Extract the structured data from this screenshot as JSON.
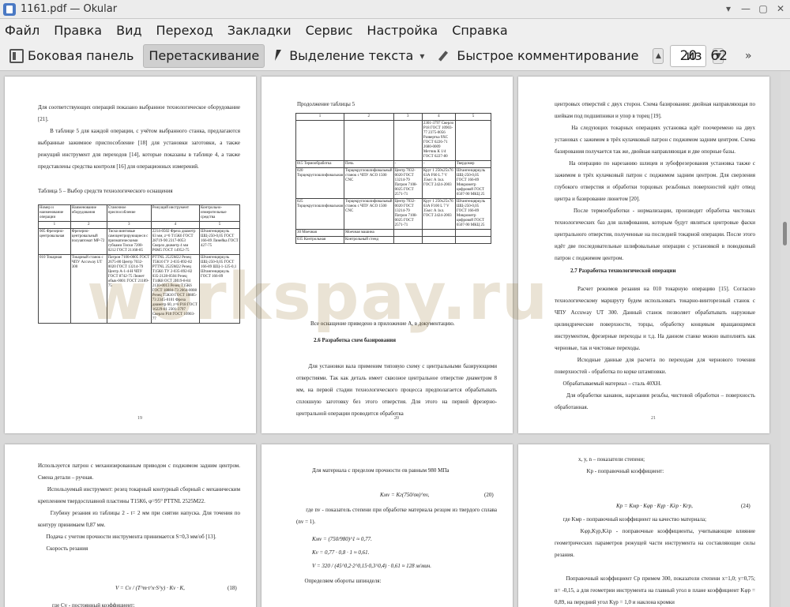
{
  "window": {
    "title": "1161.pdf — Okular",
    "controls": [
      "▾",
      "—",
      "▢",
      "✕"
    ]
  },
  "menu": [
    "Файл",
    "Правка",
    "Вид",
    "Переход",
    "Закладки",
    "Сервис",
    "Настройка",
    "Справка"
  ],
  "toolbar": {
    "sidebar": "Боковая панель",
    "drag": "Перетаскивание",
    "select_text": "Выделение текста",
    "quick_comment": "Быстрое комментирование",
    "current_page": "20",
    "of_label": "из",
    "total_pages": "62"
  },
  "watermark": "workspay.ru",
  "pages": {
    "p19": {
      "number": "19",
      "text": "Для соответствующих операций показано выбранное технологическое оборудование [21].\n      В таблице 5 для каждой операции, с учётом выбранного станка, предлагаются выбранные зажимное приспособление [18] для установки заготовки, а также режущий инструмент для переходов [14], которые показаны в таблице 4, а также представлены средства контроля [16] для операционных измерений.",
      "caption": "Таблица 5 – Выбор средств технологического оснащения",
      "table": [
        [
          "Номер и наименование операции",
          "Наименование оборудования",
          "Станочное приспособление",
          "Режущий инструмент",
          "Контрольно-измерительные средства"
        ],
        [
          "1",
          "2",
          "3",
          "4",
          "5"
        ],
        [
          "005 Фрезерно-центровальная",
          "Фрезерно-центровальный полуавтомат МР-72",
          "Тиски винтовые самоцентрирующиеся с призматическими губками Тиски 7200-0212 ГОСТ 21168-85",
          "2214-0502 Фреза диаметр 63 мм, z=6 Т15К6 ГОСТ 28719-90 2317-0053 Сверло диаметр 4 мм Р6М5 ГОСТ 14952-75",
          "Штангенциркуль ШЦ-250-0,05 ГОСТ 166-89 Линейка ГОСТ 427-75"
        ],
        [
          "010 Токарная",
          "Токарный станок с ЧПУ Accuway UT 300",
          "Патрон 7100-0005 ГОСТ 2675-80 Центр 7032-0020 ГОСТ 13214-79 Центр А-1-4-Н ЧПУ ГОСТ 8742-75 Люнет обык-0001 ГОСТ 21189-75",
          "PTTNL 2525M22 Резец T5К10 ГУ 2-035-892-82 PTTNL 2525M22 Резец T15К6 ТУ 2-035-892-82 035-2128-0504 Резец T14К8 ОСТ 2И19-8-84 2130-0013 Резец T15К6 ГОСТ 18884-73 2664-0008 Резец Т5К10 ГОСТ 18885-73 2345-0101 Фреза диаметр 60, z=8 Р18 ГОСТ 16229-81 2301-3797 Сверло Р18 ГОСТ 10903-77",
          "Штангенциркуль ШЦ-250-0,05 ГОСТ 166-89 ШЦ-1-125-0,1 Штангенциркуль ГОСТ 166-89"
        ]
      ]
    },
    "p20": {
      "number": "20",
      "title": "Продолжение таблицы 5",
      "table": [
        [
          "1",
          "2",
          "3",
          "4",
          "5"
        ],
        [
          "",
          "",
          "",
          "2301-3797 Сверло Р18 ГОСТ 10903-77 2375-0056 Развертка 9ХС ГОСТ 6226-71 2680-0009 Метчик К 1/4 ГОСТ 6227-80",
          ""
        ],
        [
          "015 Термообработка",
          "Печь",
          "-",
          "-",
          "Твердомер"
        ],
        [
          "020 Торцекруглошлифовальная",
          "Торцекруглошлифовальный станок с ЧПУ ACO 1500 CNC",
          "Центр 7032-0020 ГОСТ 13214-79 Патрон 7108-0025 ГОСТ 2571-71",
          "Круг 1 250х25х76 63А F60 L 7 V 35м/с А 1кл. ГОСТ 2424-2003",
          "Штангенциркуль ШЦ-250-0,05 ГОСТ 166-89 Микрометр цифровой ГОСТ 6507-90 МКЦ 25"
        ],
        [
          "025 Торцекруглошлифовальная",
          "Торцекруглошлифовальный станок с ЧПУ ACO 1500 CNC",
          "Центр 7032-0020 ГОСТ 13214-79 Патрон 7108-0025 ГОСТ 2571-71",
          "Круг 1 250х25х76 63А F100 L 7 V 35м/с А 1кл. ГОСТ 2424-2003",
          "Штангенциркуль ШЦ-250-0,05 ГОСТ 166-89 Микрометр цифровой ГОСТ 6507-90 МКЦ 25"
        ],
        [
          "30 Моечная",
          "Моечная машина",
          "",
          "",
          ""
        ],
        [
          "035 Контрольная",
          "Контрольный стенд",
          "",
          "",
          ""
        ]
      ],
      "note": "Все оснащение приведено в приложение А, в документацию.",
      "heading": "2.6 Разработка схем базирования",
      "text": "      Для установки вала применим типовую схему с центральными базирующими отверстиями. Так как деталь имеет сквозное центральное отверстие диаметром 8 мм, на первой стадии технологического процесса предполагается обрабатывать сплошную заготовку без этого отверстия. Для этого на первой фрезерно-центральной операции проводится обработка"
    },
    "p21": {
      "number": "21",
      "text1": "центровых отверстий с двух сторон. Схема базирования: двойная направляющая по шейкам под подшипники и упор в торец [19].\n      На следующих токарных операциях установка идёт поочеремено на двух установах с зажимом в трёх кулачковый патрон с поджимом задним центром. Схема базирования получается так же, двойная направляющая и две опорные базы.\n      На операцию по нарезанию шлицев и зубофрезерования установка также с зажимом в трёх кулачковый патрон с поджимом задним центром. Для сверления глубокого отверстия и обработки торцовых резьбовых поверхностей идёт отвод центра и базирование люнетом [20].\n      После термообработки - нормализации, производит обработка чистовых технологических баз для шлифования, которым будут являться центровые фаски центрального отверстия, полученные на последней токарной операции. После этого идёт две последовательные шлифовальные операции с установкой в поводковый патрон с поджимом центром.",
      "heading": "2.7 Разработка технологической операции",
      "text2": "      Расчет режимов резания на 010 токарную операцию [15]. Согласно технологическому маршруту будем использовать токарно-винторезный станок с ЧПУ Accuway UT 300. Данный станок позволяет обрабатывать наружные цилиндрические поверхности, торцы, обработку концевым вращающимся инструментом, фрезерные переходы и т.д. На данном станке можно выполнять как черновые, так и чистовые переходы.\n      Исходные данные для расчета по переходам для чернового точения поверхностей - обработка по корке штамповки.\n      Обрабатываемый материал – сталь 40ХН.\n      Для обработки канавок, нарезания резьбы, чистовой обработки – поверхность обработанная."
    },
    "p22": {
      "text": "Используется патрон с механизированным приводом с поджимом задним центром. Смена детали – ручная.\n      Используемый инструмент: резец токарный контурный сборный с механическим креплением твердосплавной пластины Т15К6, φ=95° PTTNL 2525M22.\n      Глубину резания из таблицы 2 - t= 2 мм при снятии напуска. Для точения по контуру принимаем 0,87 мм.\n      Подача с учетом прочности инструмента принимается S=0,3 мм/об [13].\n      Скорость резания",
      "formula": "V = Cv / (T^m·t^x·S^y) · Kv · K,",
      "formula_no": "(18)",
      "tail": "где Cv - постоянный коэффициент;"
    },
    "p23": {
      "text1": "Для материала с пределом прочности σв равным 980 МПа",
      "formula1": "Kмv = Kг(750/σв)^nv,",
      "formula1_no": "(20)",
      "text2": "      где nv - показатель степени при обработке материала резцом из твердого сплава (nv = 1).",
      "calc1": "Kмv = (750/980)^1 ≈ 0,77.",
      "calc2": "Kv = 0,77 · 0,8 · 1 ≈ 0,61.",
      "calc3": "V = 320 / (45^0,2·2^0,15·0,3^0,4) · 0,61 ≈ 128 м/мин.",
      "text3": "      Определяем обороты шпинделя:"
    },
    "p24": {
      "text1": "x, y, n – показатели степени;\n      Kр - поправочный коэффициент:",
      "formula": "Kр = Kмр · Kφр · Kγр · Kλр · Krр,",
      "formula_no": "(24)",
      "text2": "      где Kмр - поправочный коэффициент на качество материала;\n      Kφр,Kγр,Kλр - поправочные коэффициенты, учитывающие влияние геометрических параметров режущей части инструмента на составляющие силы резания.\n\n      Поправочный коэффициент Cр примем 300, показатели степени x=1,0; y=0,75; n= -0,15, а для геометрии инструмента на главный угол в плане коэффициент Kφр = 0,89, на передний угол Kγр = 1,0 и наклона кромки"
    }
  }
}
